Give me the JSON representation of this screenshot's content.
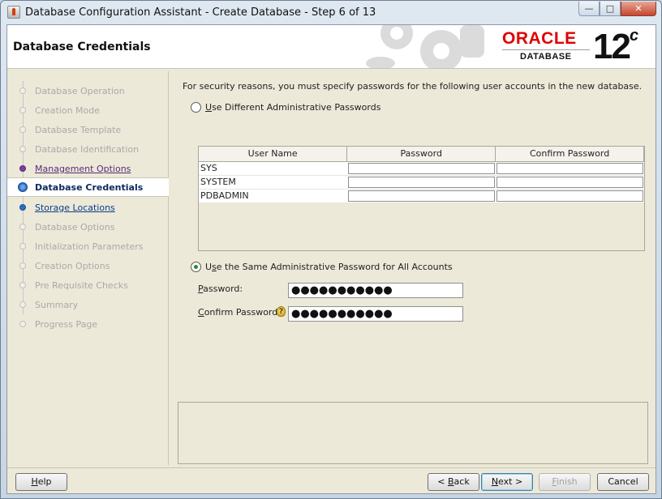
{
  "window": {
    "title": "Database Configuration Assistant - Create Database - Step 6 of 13",
    "controls": [
      "minimize",
      "maximize",
      "close"
    ]
  },
  "header": {
    "page_title": "Database Credentials",
    "logo_brand": "ORACLE",
    "logo_product": "DATABASE",
    "version": "12",
    "version_suffix": "c"
  },
  "sidebar": {
    "items": [
      {
        "label": "Database Operation",
        "state": "disabled"
      },
      {
        "label": "Creation Mode",
        "state": "disabled"
      },
      {
        "label": "Database Template",
        "state": "disabled"
      },
      {
        "label": "Database Identification",
        "state": "disabled"
      },
      {
        "label": "Management Options",
        "state": "visited"
      },
      {
        "label": "Database Credentials",
        "state": "current"
      },
      {
        "label": "Storage Locations",
        "state": "link"
      },
      {
        "label": "Database Options",
        "state": "disabled"
      },
      {
        "label": "Initialization Parameters",
        "state": "disabled"
      },
      {
        "label": "Creation Options",
        "state": "disabled"
      },
      {
        "label": "Pre Requisite Checks",
        "state": "disabled"
      },
      {
        "label": "Summary",
        "state": "disabled"
      },
      {
        "label": "Progress Page",
        "state": "disabled"
      }
    ]
  },
  "main": {
    "intro": "For security reasons, you must specify passwords for the following user accounts in the new database.",
    "option_different": {
      "mnemonic": "U",
      "rest": "se Different Administrative Passwords",
      "checked": false
    },
    "table": {
      "columns": [
        "User Name",
        "Password",
        "Confirm Password"
      ],
      "rows": [
        {
          "user": "SYS",
          "password": "",
          "confirm": ""
        },
        {
          "user": "SYSTEM",
          "password": "",
          "confirm": ""
        },
        {
          "user": "PDBADMIN",
          "password": "",
          "confirm": ""
        }
      ]
    },
    "option_same": {
      "mnemonic": "s",
      "pre": "U",
      "rest": "e the Same Administrative Password for All Accounts",
      "checked": true
    },
    "password": {
      "mnemonic": "P",
      "rest": "assword:",
      "value": "●●●●●●●●●●●"
    },
    "confirm_password": {
      "mnemonic": "C",
      "rest": "onfirm Password:",
      "value": "●●●●●●●●●●●"
    }
  },
  "buttons": {
    "help": {
      "mnemonic": "H",
      "rest": "elp"
    },
    "back": {
      "pre": "< ",
      "mnemonic": "B",
      "rest": "ack"
    },
    "next": {
      "mnemonic": "N",
      "rest": "ext >"
    },
    "finish": {
      "mnemonic": "F",
      "rest": "inish"
    },
    "cancel": {
      "label": "Cancel"
    }
  }
}
